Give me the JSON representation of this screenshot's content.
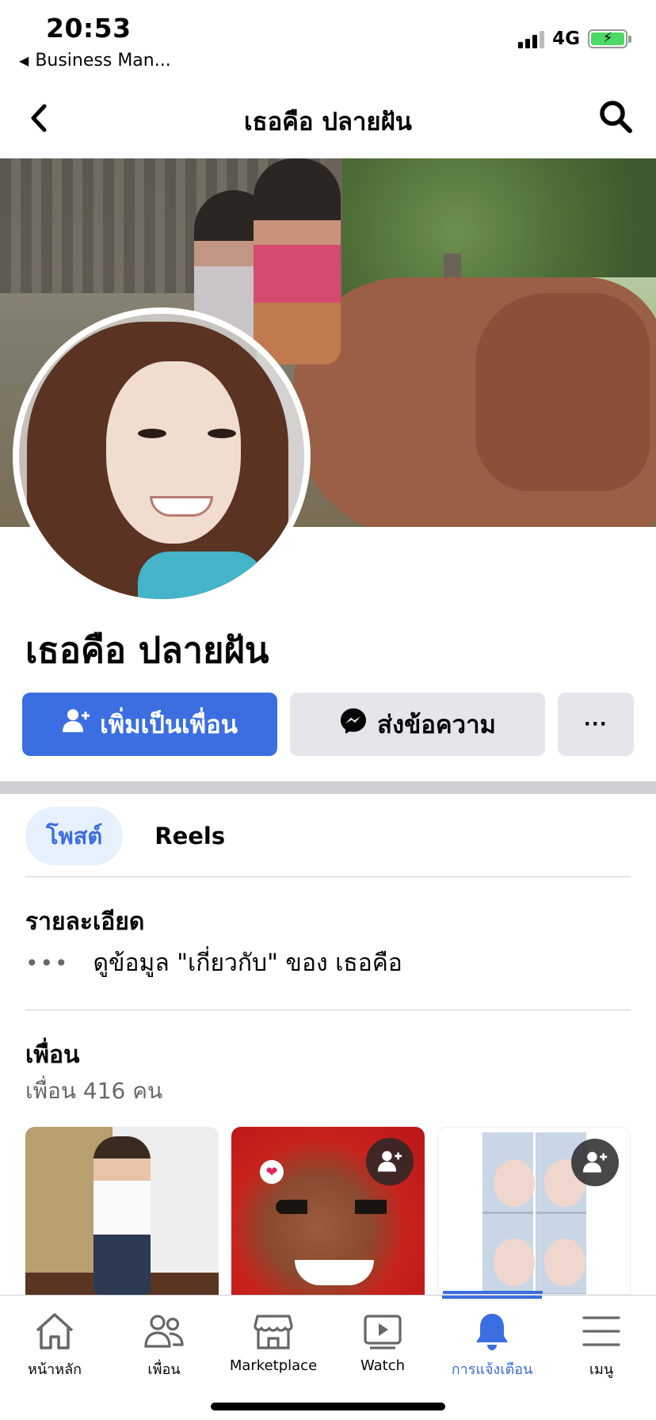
{
  "status_bar": {
    "time": "20:53",
    "back_app": "Business Man...",
    "network": "4G",
    "battery_state": "charging",
    "accent": "#4cd964"
  },
  "header": {
    "title": "เธอคือ ปลายฝัน",
    "back_icon": "chevron-left-icon",
    "search_icon": "search-icon"
  },
  "profile": {
    "name": "เธอคือ ปลายฝัน"
  },
  "actions": {
    "add_friend_label": "เพิ่มเป็นเพื่อน",
    "message_label": "ส่งข้อความ",
    "more_label": "···",
    "primary_color": "#3b6ee0"
  },
  "tabs": [
    {
      "label": "โพสต์",
      "active": true
    },
    {
      "label": "Reels",
      "active": false
    }
  ],
  "details": {
    "title": "รายละเอียด",
    "dots": "•••",
    "about_text": "ดูข้อมูล \"เกี่ยวกับ\" ของ เธอคือ"
  },
  "friends": {
    "title": "เพื่อน",
    "count_text": "เพื่อน 416 คน"
  },
  "bottom_nav": [
    {
      "label": "หน้าหลัก",
      "icon": "home-icon",
      "active": false
    },
    {
      "label": "เพื่อน",
      "icon": "friends-icon",
      "active": false
    },
    {
      "label": "Marketplace",
      "icon": "marketplace-icon",
      "active": false
    },
    {
      "label": "Watch",
      "icon": "watch-icon",
      "active": false
    },
    {
      "label": "การแจ้งเตือน",
      "icon": "bell-icon",
      "active": true
    },
    {
      "label": "เมนู",
      "icon": "menu-icon",
      "active": false
    }
  ]
}
